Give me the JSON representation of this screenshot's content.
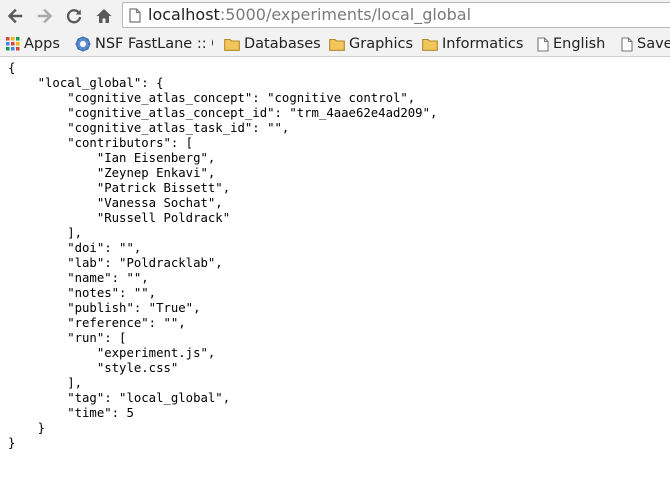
{
  "browser": {
    "url_host": "localhost",
    "url_path": ":5000/experiments/local_global"
  },
  "bookmarks": [
    {
      "label": "Apps",
      "icon": "apps-grid-icon"
    },
    {
      "label": "NSF FastLane :: G",
      "icon": "nsf-logo-icon"
    },
    {
      "label": "Databases",
      "icon": "folder-icon"
    },
    {
      "label": "Graphics",
      "icon": "folder-icon"
    },
    {
      "label": "Informatics",
      "icon": "folder-icon"
    },
    {
      "label": "English",
      "icon": "page-icon"
    },
    {
      "label": "Save",
      "icon": "page-icon"
    }
  ],
  "content": {
    "json_text": "{\n    \"local_global\": {\n        \"cognitive_atlas_concept\": \"cognitive control\",\n        \"cognitive_atlas_concept_id\": \"trm_4aae62e4ad209\",\n        \"cognitive_atlas_task_id\": \"\",\n        \"contributors\": [\n            \"Ian Eisenberg\",\n            \"Zeynep Enkavi\",\n            \"Patrick Bissett\",\n            \"Vanessa Sochat\",\n            \"Russell Poldrack\"\n        ],\n        \"doi\": \"\",\n        \"lab\": \"Poldracklab\",\n        \"name\": \"\",\n        \"notes\": \"\",\n        \"publish\": \"True\",\n        \"reference\": \"\",\n        \"run\": [\n            \"experiment.js\",\n            \"style.css\"\n        ],\n        \"tag\": \"local_global\",\n        \"time\": 5\n    }\n}"
  },
  "colors": {
    "toolbar_bg": "#f2f2f2",
    "folder_yellow": "#e8b23a",
    "disabled_gray": "#9a9a9a"
  }
}
